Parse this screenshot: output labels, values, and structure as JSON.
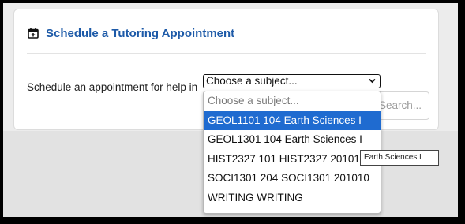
{
  "card": {
    "title": "Schedule a Tutoring Appointment",
    "icon": "calendar-plus-icon",
    "accent_color": "#1d5aa8"
  },
  "form": {
    "prompt": "Schedule an appointment for help in",
    "select_value": "Choose a subject...",
    "search_placeholder": "Search..."
  },
  "dropdown": {
    "options": [
      "Choose a subject...",
      "GEOL1101 104 Earth Sciences I",
      "GEOL1301 104 Earth Sciences I",
      "HIST2327 101 HIST2327 201010",
      "SOCI1301 204 SOCI1301 201010",
      "WRITING WRITING"
    ],
    "highlight_color": "#1f6bd0"
  },
  "tooltip": {
    "text": "Earth Sciences I"
  }
}
